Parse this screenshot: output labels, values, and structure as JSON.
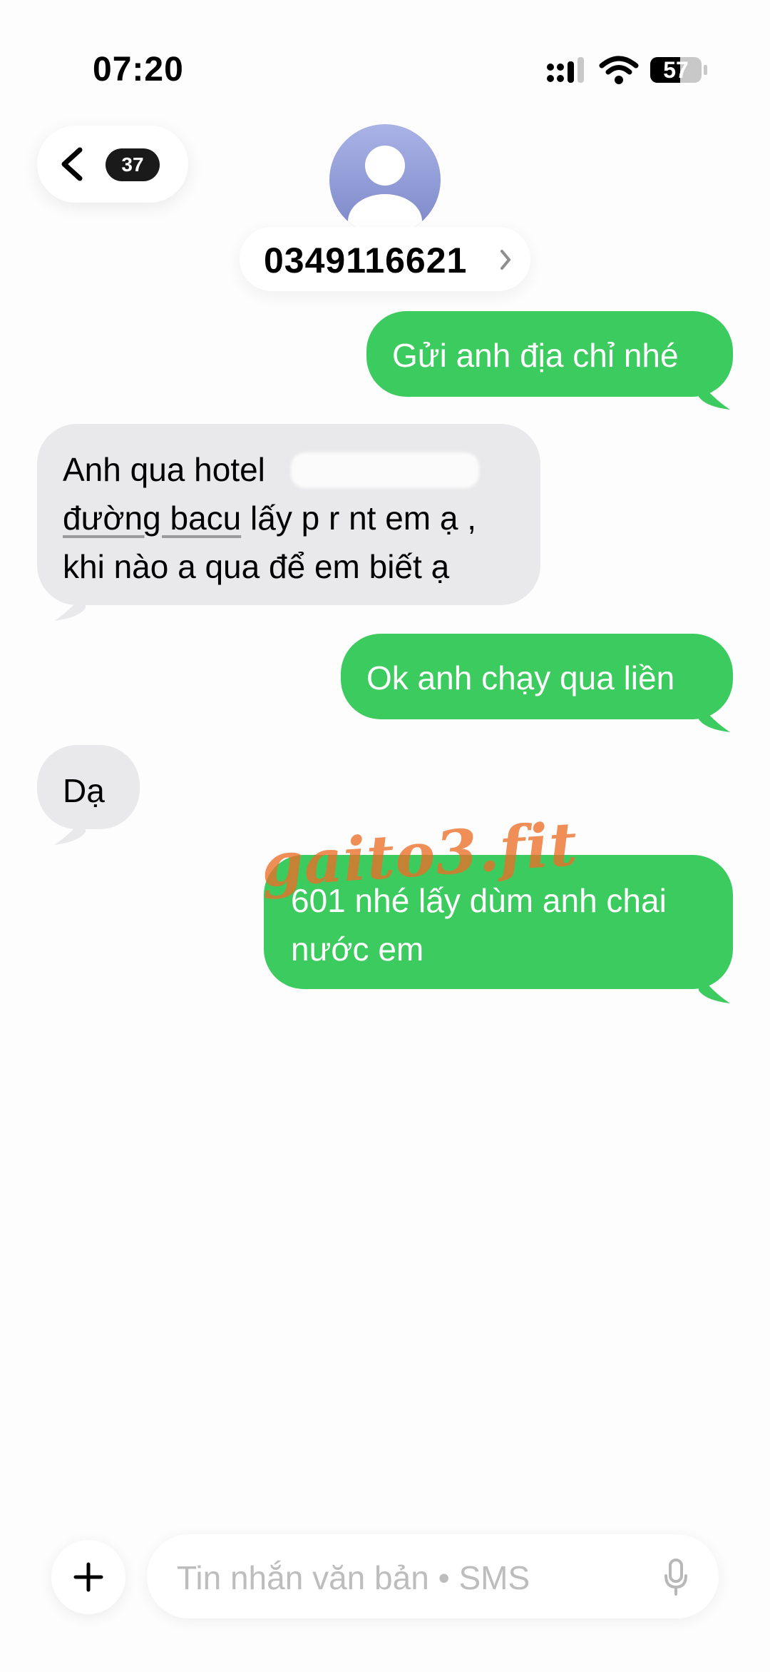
{
  "status_bar": {
    "time": "07:20",
    "battery": "57",
    "icons": [
      "signal-icon",
      "wifi-icon",
      "battery-icon"
    ]
  },
  "header": {
    "unread_count": "37",
    "contact": "0349116621",
    "icons": [
      "chevron-left-icon",
      "avatar-icon",
      "chevron-right-icon"
    ]
  },
  "messages": [
    {
      "from": "me",
      "text": "Gửi anh địa chỉ nhé"
    },
    {
      "from": "them",
      "lines": [
        "Anh qua hotel",
        "đường bacu lấy p r nt em ạ ,",
        "khi nào a qua để em biết ạ"
      ],
      "line2_link": "đường bacu",
      "line2_rest": " lấy p r nt em ạ ,"
    },
    {
      "from": "me",
      "text": "Ok anh chạy qua liền"
    },
    {
      "from": "them",
      "text": "Dạ"
    },
    {
      "from": "me",
      "lines": [
        "601 nhé lấy dùm anh chai",
        "nước em"
      ]
    }
  ],
  "watermark": "gaito3.fit",
  "composer": {
    "placeholder": "Tin nhắn văn bản • SMS",
    "icons": [
      "plus-icon",
      "mic-icon"
    ]
  },
  "colors": {
    "sent_bubble": "#3ccb5f",
    "received_bubble": "#e9e9eb",
    "background": "#fdfdfd"
  }
}
